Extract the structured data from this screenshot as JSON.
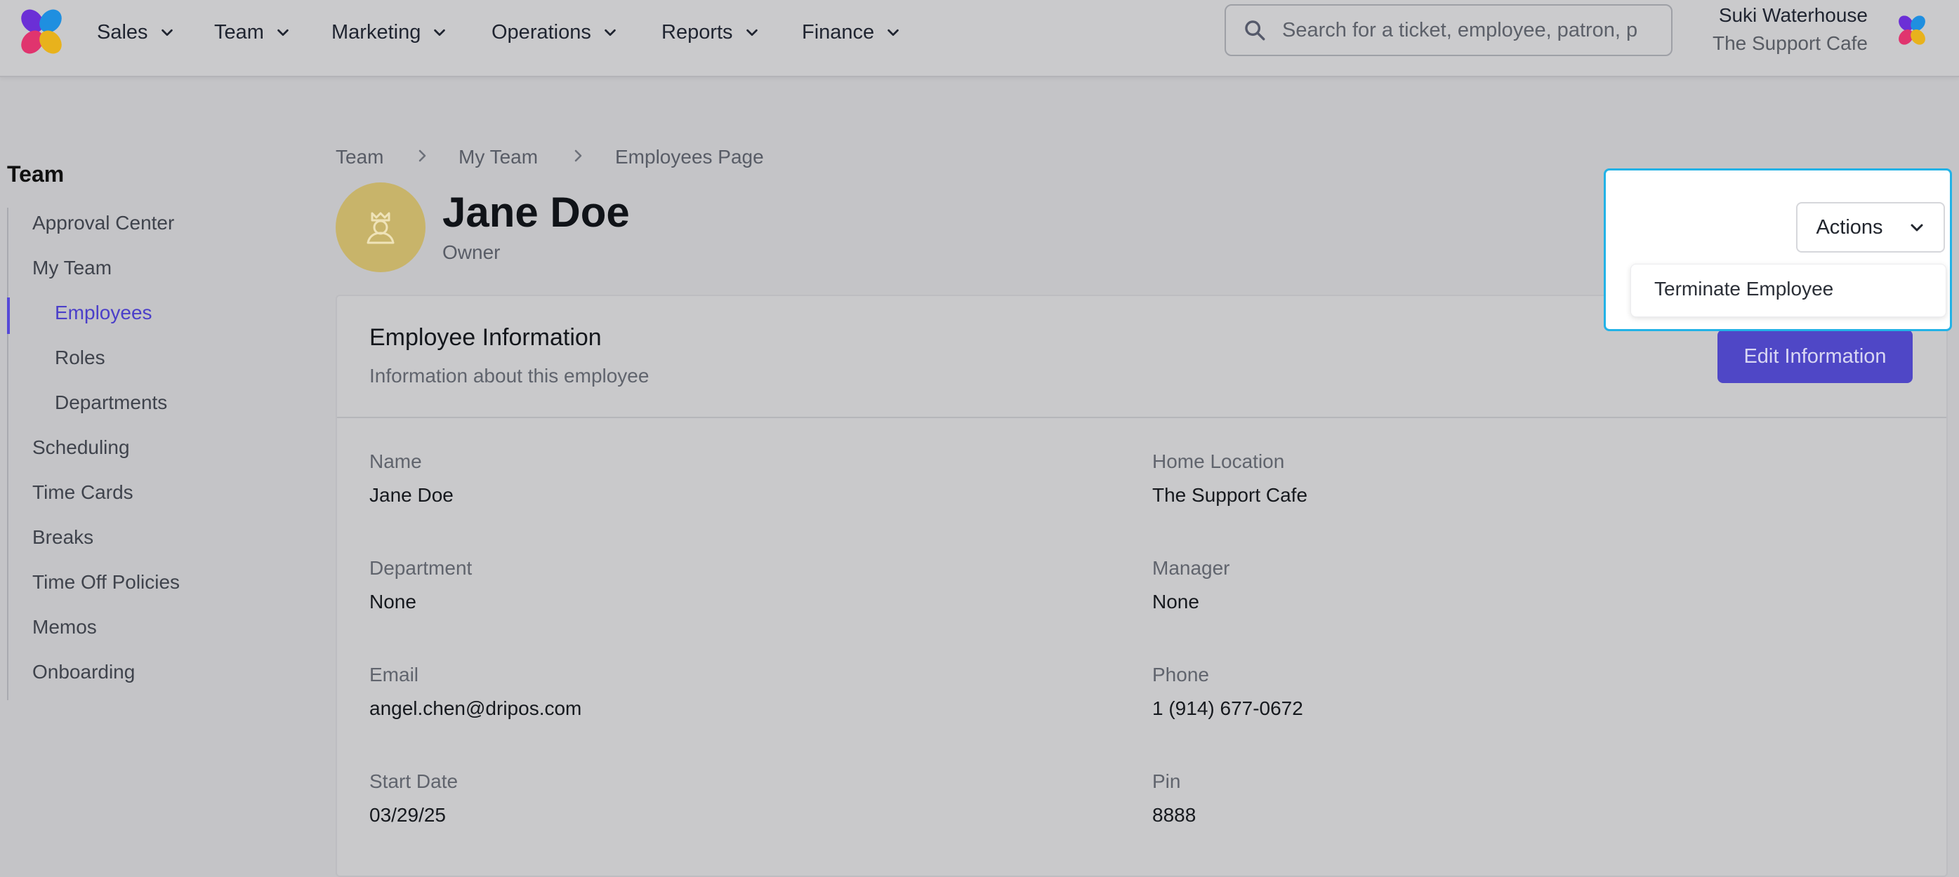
{
  "nav": {
    "items": [
      {
        "label": "Sales"
      },
      {
        "label": "Team"
      },
      {
        "label": "Marketing"
      },
      {
        "label": "Operations"
      },
      {
        "label": "Reports"
      },
      {
        "label": "Finance"
      }
    ],
    "search_placeholder": "Search for a ticket, employee, patron, p",
    "user_name": "Suki Waterhouse",
    "user_org": "The Support Cafe"
  },
  "sidebar": {
    "title": "Team",
    "items": [
      {
        "label": "Approval Center"
      },
      {
        "label": "My Team"
      },
      {
        "label": "Employees"
      },
      {
        "label": "Roles"
      },
      {
        "label": "Departments"
      },
      {
        "label": "Scheduling"
      },
      {
        "label": "Time Cards"
      },
      {
        "label": "Breaks"
      },
      {
        "label": "Time Off Policies"
      },
      {
        "label": "Memos"
      },
      {
        "label": "Onboarding"
      }
    ],
    "active_item": "Employees",
    "accent": "#5549d8"
  },
  "breadcrumb": [
    "Team",
    "My Team",
    "Employees Page"
  ],
  "employee": {
    "name": "Jane Doe",
    "role": "Owner"
  },
  "card": {
    "title": "Employee Information",
    "subtitle": "Information about this employee",
    "edit_label": "Edit Information",
    "fields": [
      {
        "label": "Name",
        "value": "Jane Doe"
      },
      {
        "label": "Home Location",
        "value": "The Support Cafe"
      },
      {
        "label": "Department",
        "value": "None"
      },
      {
        "label": "Manager",
        "value": "None"
      },
      {
        "label": "Email",
        "value": "angel.chen@dripos.com"
      },
      {
        "label": "Phone",
        "value": "1 (914) 677-0672"
      },
      {
        "label": "Start Date",
        "value": "03/29/25"
      },
      {
        "label": "Pin",
        "value": "8888"
      }
    ]
  },
  "actions": {
    "label": "Actions",
    "menu": [
      {
        "label": "Terminate Employee"
      }
    ]
  },
  "colors": {
    "primary_button": "#4f47c6",
    "highlight_frame": "#22b2e6",
    "avatar": "#c8b46a"
  }
}
